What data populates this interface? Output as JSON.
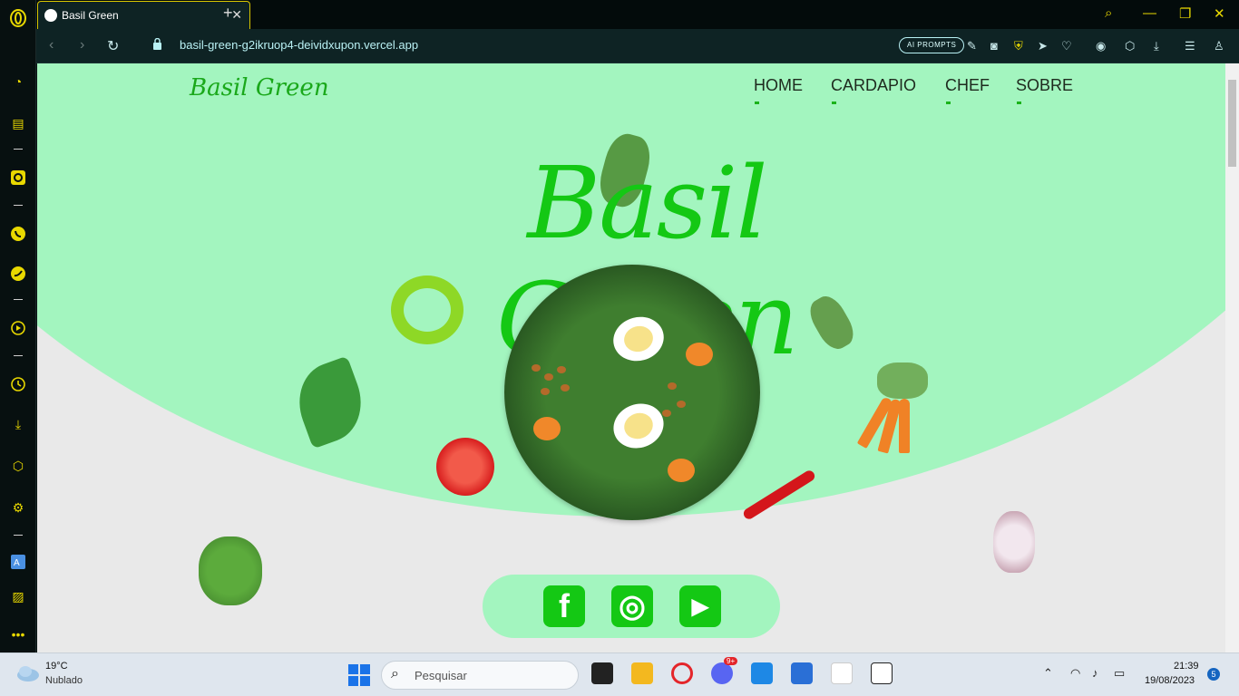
{
  "browser": {
    "tab_title": "Basil Green",
    "url": "basil-green-g2ikruop4-deividxupon.vercel.app",
    "ai_prompts_label": "AI PROMPTS"
  },
  "site": {
    "logo_text": "Basil Green",
    "hero_title": "Basil Green",
    "nav": [
      {
        "label": "HOME"
      },
      {
        "label": "CARDAPIO"
      },
      {
        "label": "CHEF"
      },
      {
        "label": "SOBRE"
      }
    ],
    "social": [
      {
        "icon": "facebook-icon",
        "glyph": "f"
      },
      {
        "icon": "instagram-icon",
        "glyph": "◎"
      },
      {
        "icon": "youtube-icon",
        "glyph": "▶"
      }
    ],
    "colors": {
      "accent": "#14c814",
      "mint": "#a3f5bf",
      "background": "#e9e9e9"
    }
  },
  "taskbar": {
    "weather_temp": "19°C",
    "weather_desc": "Nublado",
    "search_placeholder": "Pesquisar",
    "time": "21:39",
    "date": "19/08/2023",
    "notifications": "5",
    "discord_badge": "9+"
  }
}
